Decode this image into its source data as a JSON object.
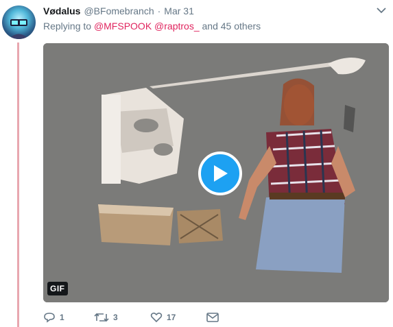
{
  "tweet": {
    "author_name": "Vødalus",
    "author_handle": "@BFomebranch",
    "separator": "·",
    "timestamp": "Mar 31",
    "reply_prefix": "Replying to",
    "mentions": [
      "@MFSPOOK",
      "@raptros_"
    ],
    "reply_suffix": "and 45 others"
  },
  "media": {
    "badge": "GIF",
    "play_icon": "play-icon"
  },
  "actions": {
    "reply_count": "1",
    "retweet_count": "3",
    "like_count": "17"
  },
  "colors": {
    "accent": "#1da1f2",
    "mention": "#e0245e",
    "thread_line": "#e8a7af",
    "muted": "#657786"
  }
}
